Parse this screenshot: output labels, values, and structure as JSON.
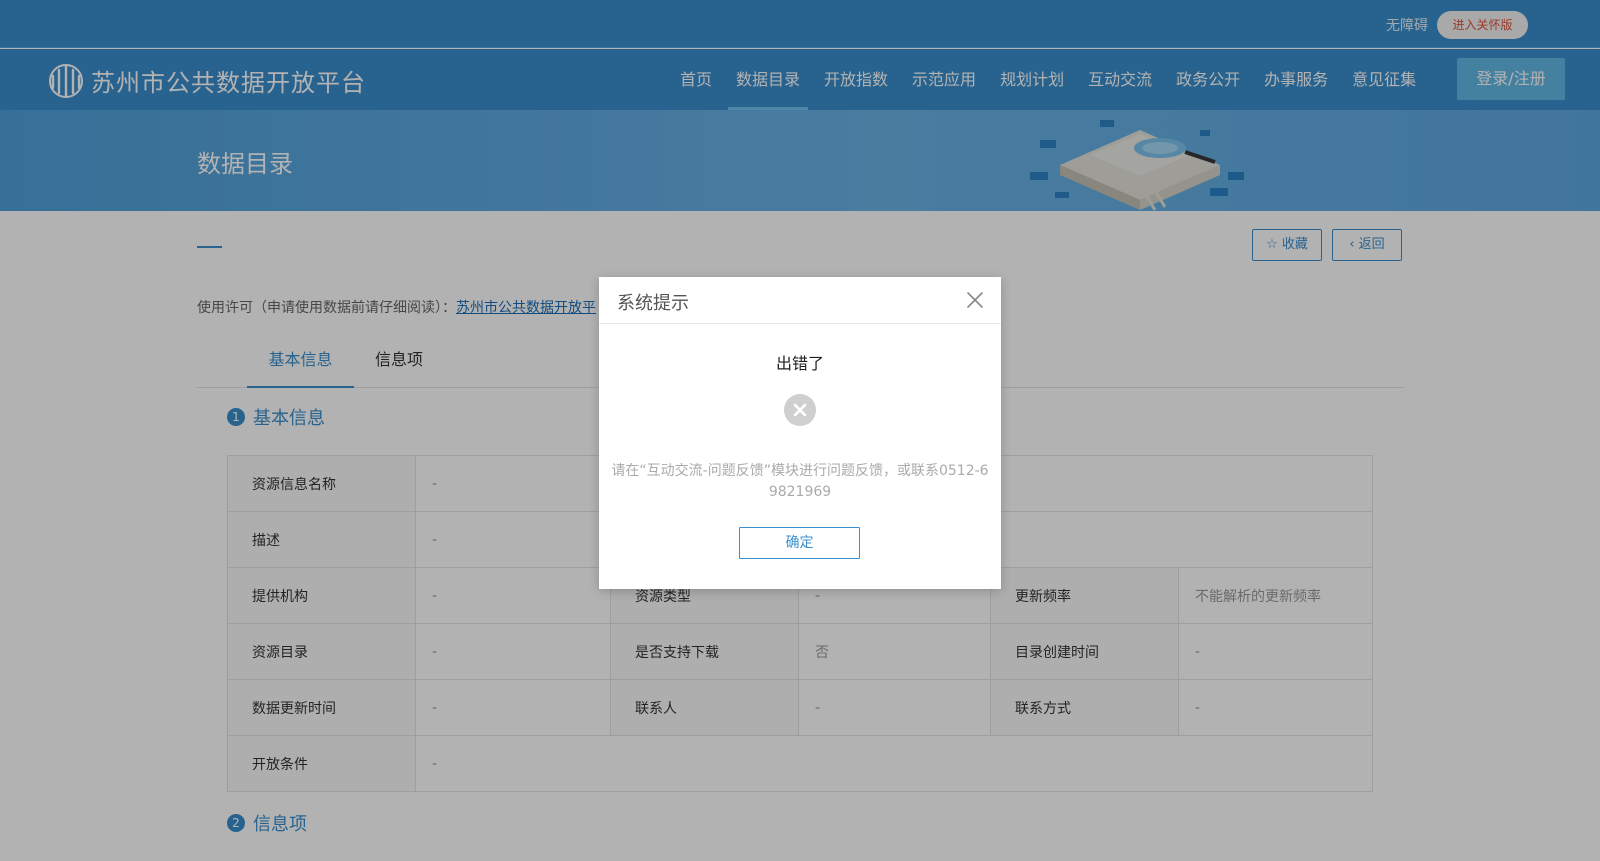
{
  "header": {
    "accessibility_label": "无障碍",
    "care_mode_label": "进入关怀版",
    "site_title": "苏州市公共数据开放平台",
    "login_label": "登录/注册",
    "nav_items": [
      "首页",
      "数据目录",
      "开放指数",
      "示范应用",
      "规划计划",
      "互动交流",
      "政务公开",
      "办事服务",
      "意见征集"
    ],
    "active_nav": "数据目录"
  },
  "banner": {
    "heading": "数据目录"
  },
  "actions": {
    "favorite_label": "☆ 收藏",
    "back_label": "‹ 返回"
  },
  "license": {
    "prefix": "使用许可（申请使用数据前请仔细阅读）：",
    "link_text": "苏州市公共数据开放平"
  },
  "tabs": [
    "基本信息",
    "信息项"
  ],
  "sections": {
    "basic": {
      "num": "1",
      "title": "基本信息"
    },
    "items": {
      "num": "2",
      "title": "信息项"
    }
  },
  "info_table": {
    "resource_name_label": "资源信息名称",
    "resource_name_value": "-",
    "description_label": "描述",
    "description_value": "-",
    "provider_label": "提供机构",
    "provider_value": "-",
    "resource_type_label": "资源类型",
    "resource_type_value": "-",
    "update_freq_label": "更新频率",
    "update_freq_value": "不能解析的更新频率",
    "catalog_label": "资源目录",
    "catalog_value": "-",
    "download_label": "是否支持下载",
    "download_value": "否",
    "created_label": "目录创建时间",
    "created_value": "-",
    "data_updated_label": "数据更新时间",
    "data_updated_value": "-",
    "contact_label": "联系人",
    "contact_value": "-",
    "contact_method_label": "联系方式",
    "contact_method_value": "-",
    "open_cond_label": "开放条件",
    "open_cond_value": "-"
  },
  "dialog": {
    "title": "系统提示",
    "message": "出错了",
    "description": "请在“互动交流-问题反馈”模块进行问题反馈，或联系0512-69821969",
    "ok_label": "确定"
  },
  "colors": {
    "primary": "#3a8fcd",
    "accent_red": "#e0533a",
    "overlay": "rgba(0,0,0,0.30)"
  }
}
